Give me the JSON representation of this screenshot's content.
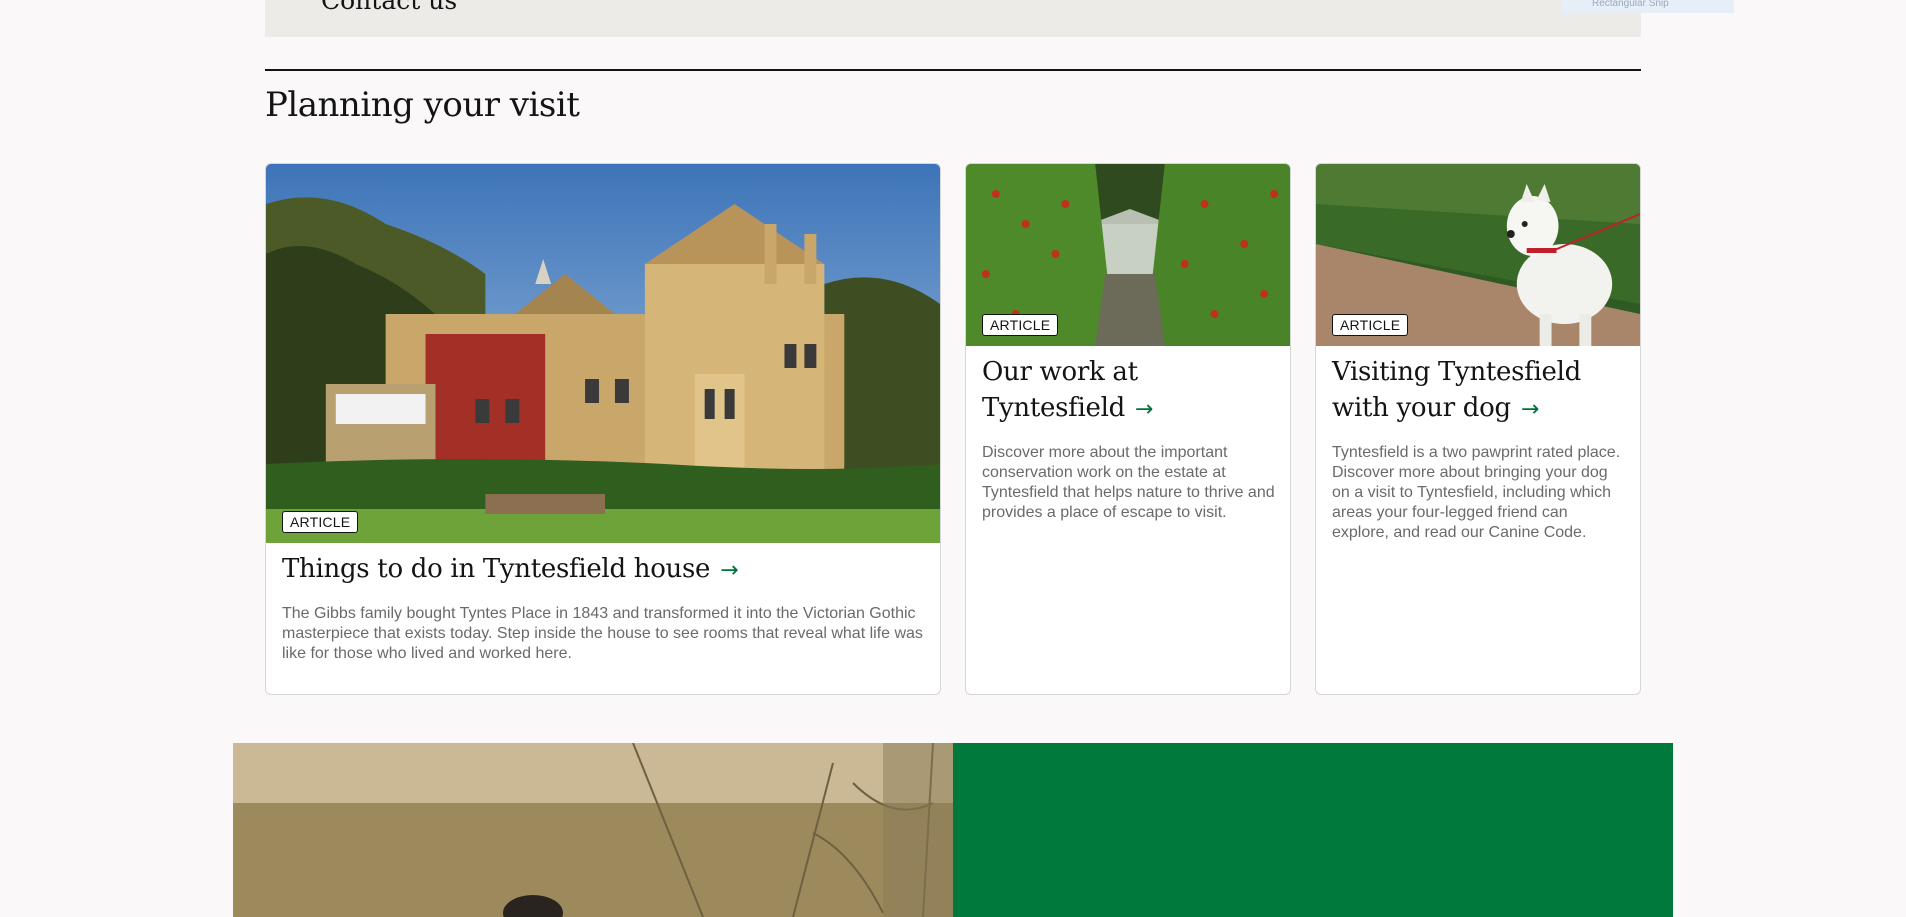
{
  "top_strip": {
    "contact_text": "Contact us",
    "snip_text": "Rectangular Snip"
  },
  "section": {
    "title": "Planning your visit"
  },
  "cards": [
    {
      "tag": "ARTICLE",
      "title": "Things to do in Tyntesfield house",
      "arrow": "→",
      "description": "The Gibbs family bought Tyntes Place in 1843 and transformed it into the Victorian Gothic masterpiece that exists today. Step inside the house to see rooms that reveal what life was like for those who lived and worked here."
    },
    {
      "tag": "ARTICLE",
      "title": "Our work at Tyntesfield",
      "arrow": "→",
      "description": "Discover more about the important conservation work on the estate at Tyntesfield that helps nature to thrive and provides a place of escape to visit."
    },
    {
      "tag": "ARTICLE",
      "title": "Visiting Tyntesfield with your dog",
      "arrow": "→",
      "description": "Tyntesfield is a two pawprint rated place. Discover more about bringing your dog on a visit to Tyntesfield, including which areas your four-legged friend can explore, and read our Canine Code."
    }
  ],
  "colors": {
    "accent_green": "#00733a",
    "promo_green": "#00793c",
    "page_background": "#faf8f8"
  },
  "icons": {
    "card_arrow": "arrow-right-icon"
  }
}
